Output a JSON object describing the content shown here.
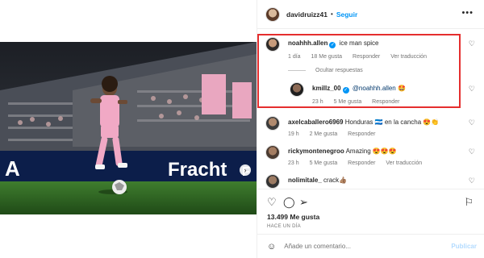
{
  "post": {
    "author": "davidruizz41",
    "separator": "•",
    "follow_label": "Seguir",
    "more_icon": "more-horizontal-icon"
  },
  "photo": {
    "ad_text": "Fracht",
    "ad_text_right": "F",
    "letter_left": "A",
    "dots_count": 3,
    "active_dot": 1
  },
  "comments": [
    {
      "user": "noahhh.allen",
      "verified": true,
      "text": "ice man spice",
      "time": "1 día",
      "likes": "18 Me gusta",
      "reply_label": "Responder",
      "translate_label": "Ver traducción"
    },
    {
      "user": "kmillz_00",
      "verified": true,
      "mention": "@noahhh.allen",
      "text": "🤩",
      "time": "23 h",
      "likes": "5 Me gusta",
      "reply_label": "Responder"
    },
    {
      "user": "axelcaballero6969",
      "verified": false,
      "text": "Honduras 🇭🇳 en la cancha 😍👏",
      "time": "19 h",
      "likes": "2 Me gusta",
      "reply_label": "Responder"
    },
    {
      "user": "rickymontenegroo",
      "verified": false,
      "text": "Amazing 😍😍😍",
      "time": "23 h",
      "likes": "5 Me gusta",
      "reply_label": "Responder",
      "translate_label": "Ver traducción"
    },
    {
      "user": "nolimitale_",
      "verified": false,
      "text": "crack👍🏽"
    }
  ],
  "hide_replies_label": "Ocultar respuestas",
  "actions": {
    "like_icon": "heart-icon",
    "comment_icon": "comment-icon",
    "share_icon": "share-icon",
    "save_icon": "bookmark-icon"
  },
  "likes_total": "13.499 Me gusta",
  "posted_ago": "HACE UN DÍA",
  "add_comment": {
    "placeholder": "Añade un comentario...",
    "publish_label": "Publicar"
  },
  "colors": {
    "link_blue": "#0095f6",
    "highlight_red": "#e52e2e",
    "muted": "#737373"
  }
}
